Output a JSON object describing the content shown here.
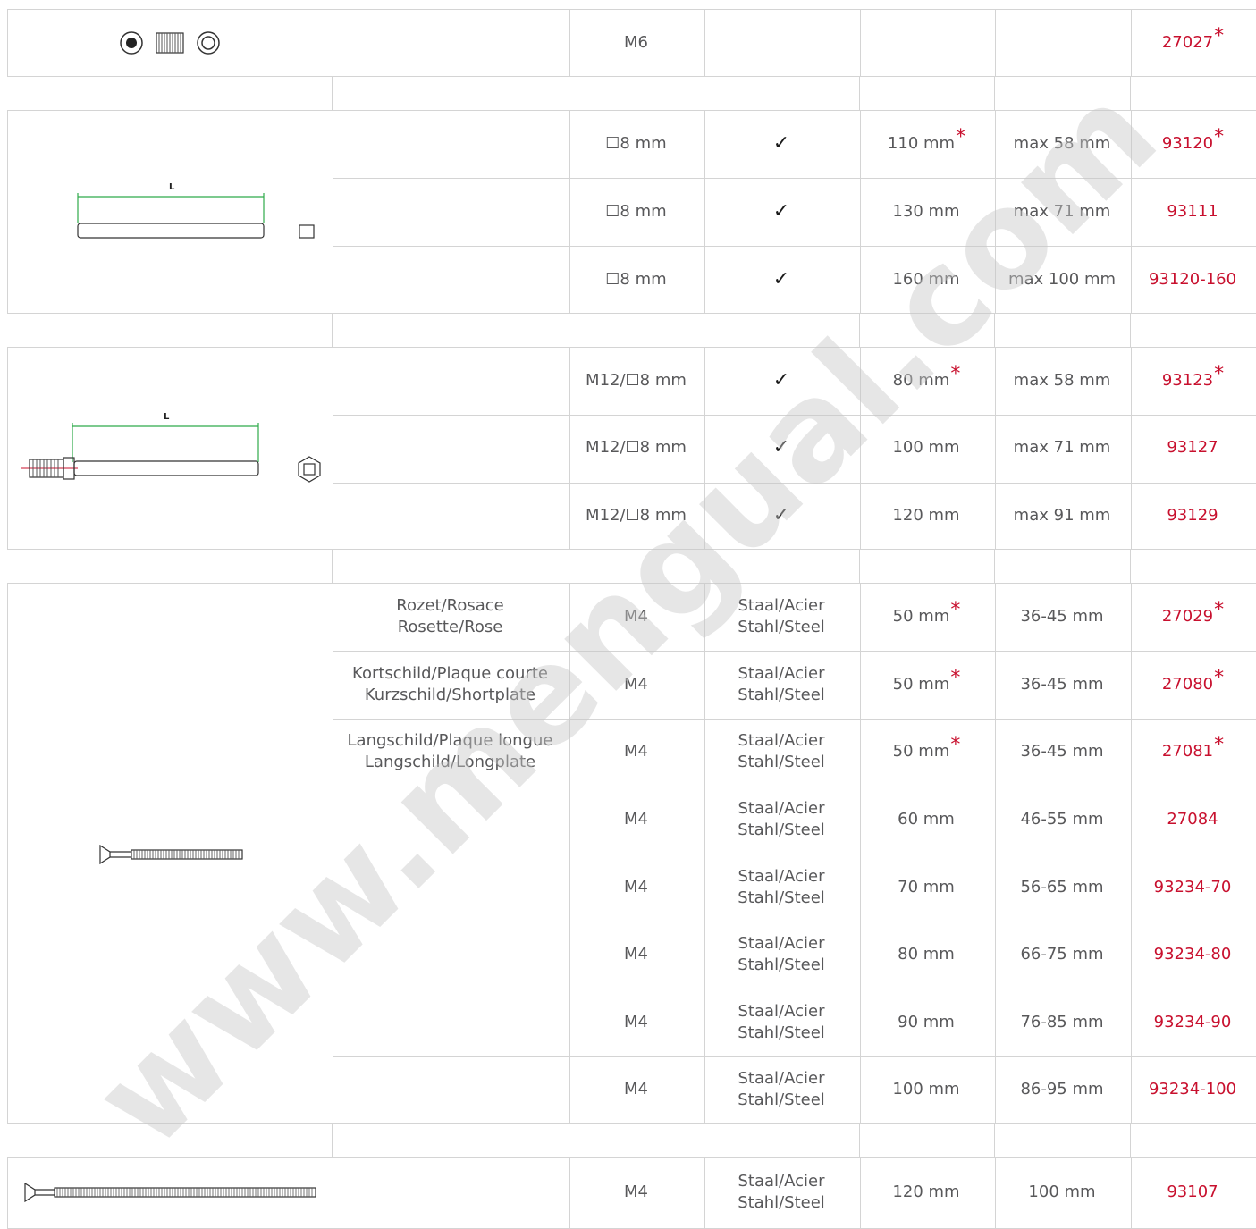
{
  "watermark": "www.mengual.com",
  "accent_color": "#c8102e",
  "groups": [
    {
      "illustration": "grub-screw-icons",
      "rows": [
        {
          "description": "",
          "thread": "M6",
          "material": "",
          "length": "",
          "length_star": "",
          "range": "",
          "code": "27027",
          "code_star": "*"
        }
      ]
    },
    {
      "illustration": "square-spindle",
      "dimension_label": "L",
      "rows": [
        {
          "description": "",
          "thread": "☐8 mm",
          "material": "✓",
          "length": "110 mm",
          "length_star": "*",
          "range": "max 58 mm",
          "code": "93120",
          "code_star": "*"
        },
        {
          "description": "",
          "thread": "☐8 mm",
          "material": "✓",
          "length": "130 mm",
          "length_star": "",
          "range": "max 71 mm",
          "code": "93111",
          "code_star": ""
        },
        {
          "description": "",
          "thread": "☐8 mm",
          "material": "✓",
          "length": "160 mm",
          "length_star": "",
          "range": "max 100 mm",
          "code": "93120-160",
          "code_star": ""
        }
      ]
    },
    {
      "illustration": "threaded-spindle",
      "dimension_label": "L",
      "rows": [
        {
          "description": "",
          "thread": "M12/☐8 mm",
          "material": "✓",
          "length": "80 mm",
          "length_star": "*",
          "range": "max 58 mm",
          "code": "93123",
          "code_star": "*"
        },
        {
          "description": "",
          "thread": "M12/☐8 mm",
          "material": "✓",
          "length": "100 mm",
          "length_star": "",
          "range": "max 71 mm",
          "code": "93127",
          "code_star": ""
        },
        {
          "description": "",
          "thread": "M12/☐8 mm",
          "material": "✓",
          "length": "120 mm",
          "length_star": "",
          "range": "max 91 mm",
          "code": "93129",
          "code_star": ""
        }
      ]
    },
    {
      "illustration": "countersunk-screw",
      "rows": [
        {
          "description": "Rozet/Rosace",
          "description2": "Rosette/Rose",
          "thread": "M4",
          "material": "Staal/Acier",
          "material2": "Stahl/Steel",
          "length": "50 mm",
          "length_star": "*",
          "range": "36-45 mm",
          "code": "27029",
          "code_star": "*"
        },
        {
          "description": "Kortschild/Plaque courte",
          "description2": "Kurzschild/Shortplate",
          "thread": "M4",
          "material": "Staal/Acier",
          "material2": "Stahl/Steel",
          "length": "50 mm",
          "length_star": "*",
          "range": "36-45 mm",
          "code": "27080",
          "code_star": "*"
        },
        {
          "description": "Langschild/Plaque longue",
          "description2": "Langschild/Longplate",
          "thread": "M4",
          "material": "Staal/Acier",
          "material2": "Stahl/Steel",
          "length": "50 mm",
          "length_star": "*",
          "range": "36-45 mm",
          "code": "27081",
          "code_star": "*"
        },
        {
          "description": "",
          "thread": "M4",
          "material": "Staal/Acier",
          "material2": "Stahl/Steel",
          "length": "60 mm",
          "length_star": "",
          "range": "46-55 mm",
          "code": "27084",
          "code_star": ""
        },
        {
          "description": "",
          "thread": "M4",
          "material": "Staal/Acier",
          "material2": "Stahl/Steel",
          "length": "70 mm",
          "length_star": "",
          "range": "56-65 mm",
          "code": "93234-70",
          "code_star": ""
        },
        {
          "description": "",
          "thread": "M4",
          "material": "Staal/Acier",
          "material2": "Stahl/Steel",
          "length": "80 mm",
          "length_star": "",
          "range": "66-75 mm",
          "code": "93234-80",
          "code_star": ""
        },
        {
          "description": "",
          "thread": "M4",
          "material": "Staal/Acier",
          "material2": "Stahl/Steel",
          "length": "90 mm",
          "length_star": "",
          "range": "76-85 mm",
          "code": "93234-90",
          "code_star": ""
        },
        {
          "description": "",
          "thread": "M4",
          "material": "Staal/Acier",
          "material2": "Stahl/Steel",
          "length": "100 mm",
          "length_star": "",
          "range": "86-95 mm",
          "code": "93234-100",
          "code_star": ""
        }
      ]
    },
    {
      "illustration": "long-countersunk-screw",
      "rows": [
        {
          "description": "",
          "thread": "M4",
          "material": "Staal/Acier",
          "material2": "Stahl/Steel",
          "length": "120 mm",
          "length_star": "",
          "range": "100 mm",
          "code": "93107",
          "code_star": ""
        }
      ]
    }
  ]
}
